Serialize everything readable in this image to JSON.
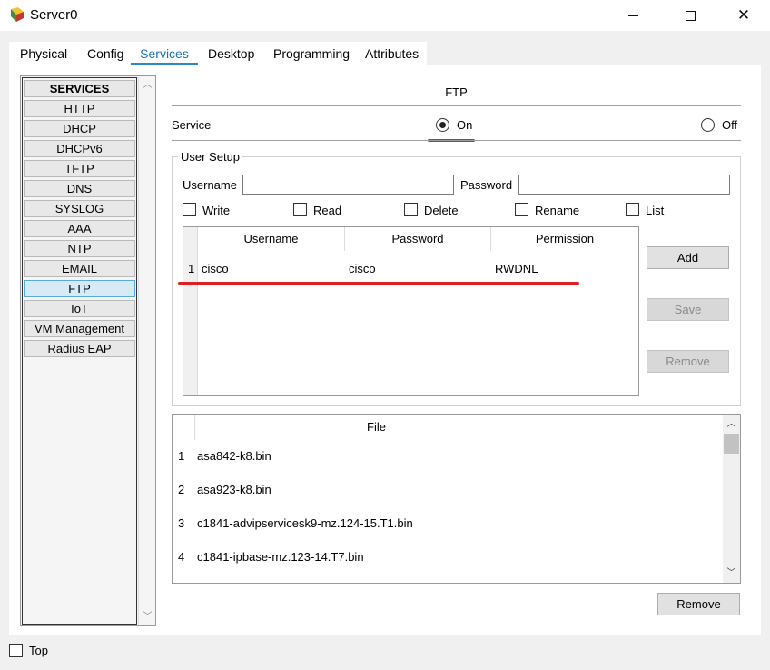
{
  "window": {
    "title": "Server0",
    "min_icon": "minimize-icon",
    "max_icon": "maximize-icon",
    "close_glyph": "✕"
  },
  "tabs": [
    "Physical",
    "Config",
    "Services",
    "Desktop",
    "Programming",
    "Attributes"
  ],
  "active_tab": "Services",
  "services": {
    "header": "SERVICES",
    "items": [
      "HTTP",
      "DHCP",
      "DHCPv6",
      "TFTP",
      "DNS",
      "SYSLOG",
      "AAA",
      "NTP",
      "EMAIL",
      "FTP",
      "IoT",
      "VM Management",
      "Radius EAP"
    ],
    "selected": "FTP"
  },
  "ftp": {
    "title": "FTP",
    "service_label": "Service",
    "on_label": "On",
    "off_label": "Off",
    "selected": "On"
  },
  "user_setup": {
    "legend": "User Setup",
    "username_label": "Username",
    "password_label": "Password",
    "username_value": "",
    "password_value": "",
    "permissions": [
      "Write",
      "Read",
      "Delete",
      "Rename",
      "List"
    ],
    "table_headers": [
      "Username",
      "Password",
      "Permission"
    ],
    "rows": [
      {
        "num": "1",
        "username": "cisco",
        "password": "cisco",
        "permission": "RWDNL"
      }
    ],
    "add_label": "Add",
    "save_label": "Save",
    "remove_label": "Remove"
  },
  "files": {
    "header": "File",
    "items": [
      {
        "num": "1",
        "name": "asa842-k8.bin"
      },
      {
        "num": "2",
        "name": "asa923-k8.bin"
      },
      {
        "num": "3",
        "name": "c1841-advipservicesk9-mz.124-15.T1.bin"
      },
      {
        "num": "4",
        "name": "c1841-ipbase-mz.123-14.T7.bin"
      }
    ],
    "remove_label": "Remove"
  },
  "footer": {
    "top_label": "Top"
  },
  "colors": {
    "accent": "#2a88c8",
    "annotation_red": "#e02020"
  }
}
